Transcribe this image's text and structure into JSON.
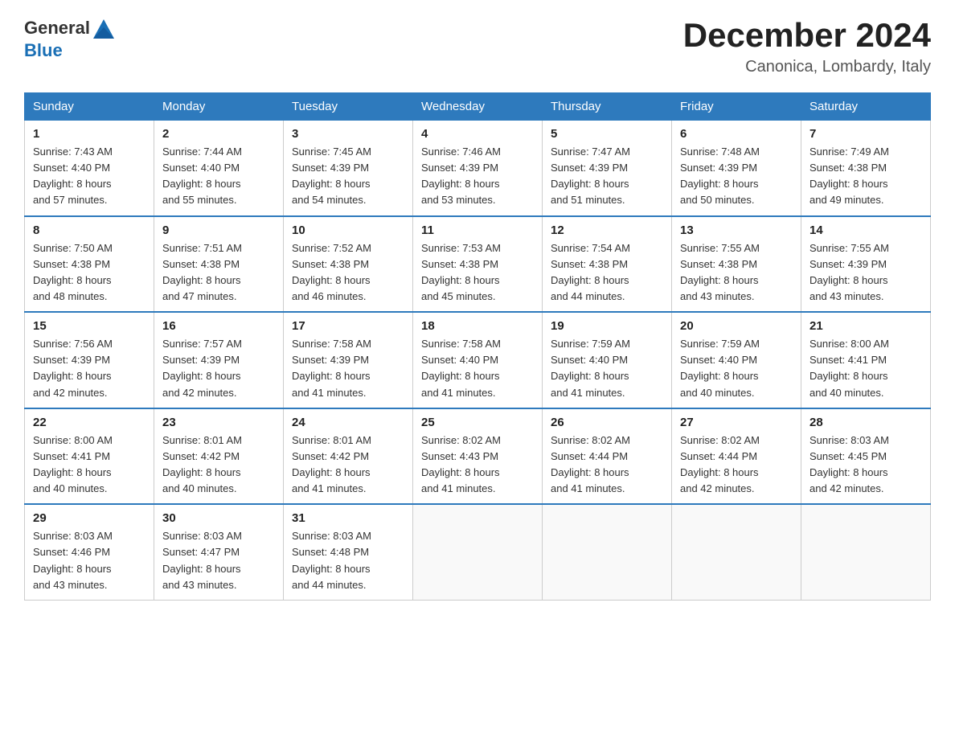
{
  "header": {
    "logo_general": "General",
    "logo_blue": "Blue",
    "month_title": "December 2024",
    "location": "Canonica, Lombardy, Italy"
  },
  "columns": [
    "Sunday",
    "Monday",
    "Tuesday",
    "Wednesday",
    "Thursday",
    "Friday",
    "Saturday"
  ],
  "weeks": [
    [
      {
        "day": "1",
        "sunrise": "7:43 AM",
        "sunset": "4:40 PM",
        "daylight": "8 hours and 57 minutes."
      },
      {
        "day": "2",
        "sunrise": "7:44 AM",
        "sunset": "4:40 PM",
        "daylight": "8 hours and 55 minutes."
      },
      {
        "day": "3",
        "sunrise": "7:45 AM",
        "sunset": "4:39 PM",
        "daylight": "8 hours and 54 minutes."
      },
      {
        "day": "4",
        "sunrise": "7:46 AM",
        "sunset": "4:39 PM",
        "daylight": "8 hours and 53 minutes."
      },
      {
        "day": "5",
        "sunrise": "7:47 AM",
        "sunset": "4:39 PM",
        "daylight": "8 hours and 51 minutes."
      },
      {
        "day": "6",
        "sunrise": "7:48 AM",
        "sunset": "4:39 PM",
        "daylight": "8 hours and 50 minutes."
      },
      {
        "day": "7",
        "sunrise": "7:49 AM",
        "sunset": "4:38 PM",
        "daylight": "8 hours and 49 minutes."
      }
    ],
    [
      {
        "day": "8",
        "sunrise": "7:50 AM",
        "sunset": "4:38 PM",
        "daylight": "8 hours and 48 minutes."
      },
      {
        "day": "9",
        "sunrise": "7:51 AM",
        "sunset": "4:38 PM",
        "daylight": "8 hours and 47 minutes."
      },
      {
        "day": "10",
        "sunrise": "7:52 AM",
        "sunset": "4:38 PM",
        "daylight": "8 hours and 46 minutes."
      },
      {
        "day": "11",
        "sunrise": "7:53 AM",
        "sunset": "4:38 PM",
        "daylight": "8 hours and 45 minutes."
      },
      {
        "day": "12",
        "sunrise": "7:54 AM",
        "sunset": "4:38 PM",
        "daylight": "8 hours and 44 minutes."
      },
      {
        "day": "13",
        "sunrise": "7:55 AM",
        "sunset": "4:38 PM",
        "daylight": "8 hours and 43 minutes."
      },
      {
        "day": "14",
        "sunrise": "7:55 AM",
        "sunset": "4:39 PM",
        "daylight": "8 hours and 43 minutes."
      }
    ],
    [
      {
        "day": "15",
        "sunrise": "7:56 AM",
        "sunset": "4:39 PM",
        "daylight": "8 hours and 42 minutes."
      },
      {
        "day": "16",
        "sunrise": "7:57 AM",
        "sunset": "4:39 PM",
        "daylight": "8 hours and 42 minutes."
      },
      {
        "day": "17",
        "sunrise": "7:58 AM",
        "sunset": "4:39 PM",
        "daylight": "8 hours and 41 minutes."
      },
      {
        "day": "18",
        "sunrise": "7:58 AM",
        "sunset": "4:40 PM",
        "daylight": "8 hours and 41 minutes."
      },
      {
        "day": "19",
        "sunrise": "7:59 AM",
        "sunset": "4:40 PM",
        "daylight": "8 hours and 41 minutes."
      },
      {
        "day": "20",
        "sunrise": "7:59 AM",
        "sunset": "4:40 PM",
        "daylight": "8 hours and 40 minutes."
      },
      {
        "day": "21",
        "sunrise": "8:00 AM",
        "sunset": "4:41 PM",
        "daylight": "8 hours and 40 minutes."
      }
    ],
    [
      {
        "day": "22",
        "sunrise": "8:00 AM",
        "sunset": "4:41 PM",
        "daylight": "8 hours and 40 minutes."
      },
      {
        "day": "23",
        "sunrise": "8:01 AM",
        "sunset": "4:42 PM",
        "daylight": "8 hours and 40 minutes."
      },
      {
        "day": "24",
        "sunrise": "8:01 AM",
        "sunset": "4:42 PM",
        "daylight": "8 hours and 41 minutes."
      },
      {
        "day": "25",
        "sunrise": "8:02 AM",
        "sunset": "4:43 PM",
        "daylight": "8 hours and 41 minutes."
      },
      {
        "day": "26",
        "sunrise": "8:02 AM",
        "sunset": "4:44 PM",
        "daylight": "8 hours and 41 minutes."
      },
      {
        "day": "27",
        "sunrise": "8:02 AM",
        "sunset": "4:44 PM",
        "daylight": "8 hours and 42 minutes."
      },
      {
        "day": "28",
        "sunrise": "8:03 AM",
        "sunset": "4:45 PM",
        "daylight": "8 hours and 42 minutes."
      }
    ],
    [
      {
        "day": "29",
        "sunrise": "8:03 AM",
        "sunset": "4:46 PM",
        "daylight": "8 hours and 43 minutes."
      },
      {
        "day": "30",
        "sunrise": "8:03 AM",
        "sunset": "4:47 PM",
        "daylight": "8 hours and 43 minutes."
      },
      {
        "day": "31",
        "sunrise": "8:03 AM",
        "sunset": "4:48 PM",
        "daylight": "8 hours and 44 minutes."
      },
      null,
      null,
      null,
      null
    ]
  ],
  "labels": {
    "sunrise_prefix": "Sunrise: ",
    "sunset_prefix": "Sunset: ",
    "daylight_prefix": "Daylight: "
  }
}
